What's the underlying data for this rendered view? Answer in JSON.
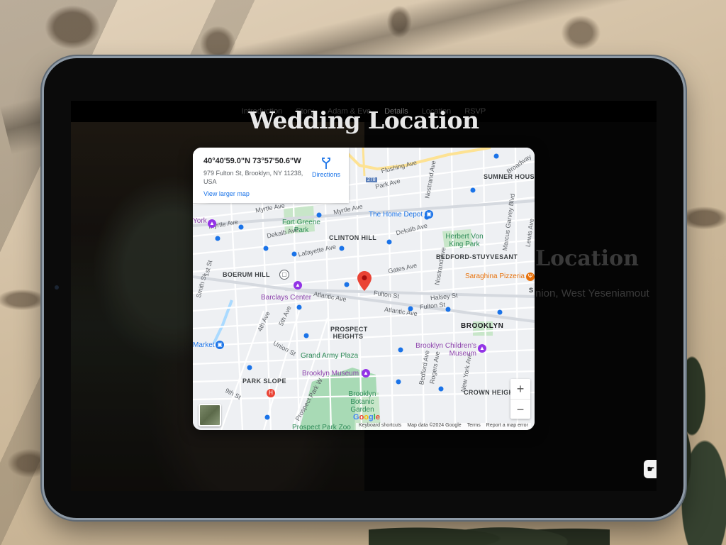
{
  "nav": {
    "items": [
      "Introduction",
      "Story",
      "Adam & Eve",
      "Details",
      "Location",
      "RSVP"
    ],
    "active": "Details"
  },
  "page": {
    "title": "Wedding Location",
    "bg_heading": "Location",
    "bg_address": "nion, West Yeseniamout"
  },
  "map": {
    "info": {
      "coords": "40°40'59.0\"N 73°57'50.6\"W",
      "address": "979 Fulton St, Brooklyn, NY 11238, USA",
      "larger_map": "View larger map",
      "directions": "Directions"
    },
    "labels": {
      "flushing_ave": "Flushing Ave",
      "park_ave": "Park Ave",
      "myrtle_ave_1": "Myrtle Ave",
      "myrtle_ave_2": "Myrtle Ave",
      "myrtle_ave_3": "Myrtle Ave",
      "dekalb_ave_1": "Dekalb Ave",
      "dekalb_ave_2": "Dekalb Ave",
      "lafayette_ave": "Lafayette Ave",
      "gates_ave": "Gates Ave",
      "fulton_st_1": "Fulton St",
      "fulton_st_2": "Fulton St",
      "halsey_st": "Halsey St",
      "atlantic_ave_1": "Atlantic Ave",
      "atlantic_ave_2": "Atlantic Ave",
      "union_st": "Union St",
      "ninth_st": "9th St",
      "fourth_ave": "4th Ave",
      "fifth_ave": "5th Ave",
      "smith_st": "Smith St",
      "first_st": "1st St",
      "prospect_park_w": "Prospect Park W",
      "bedford_ave": "Bedford Ave",
      "rogers_ave": "Rogers Ave",
      "new_york_ave": "New York Ave",
      "nostrand_ave_1": "Nostrand Ave",
      "nostrand_ave_2": "Nostrand Ave",
      "broadway": "Broadway",
      "marcus_garvey": "Marcus Garvey Blvd",
      "lewis_ave": "Lewis Ave",
      "route_278": "278",
      "sumner_houses": "SUMNER HOUSES",
      "clinton_hill": "CLINTON HILL",
      "boerum_hill": "BOERUM HILL",
      "bedford_stuyvesant": "BEDFORD-STUYVESANT",
      "prospect_heights": "PROSPECT HEIGHTS",
      "brooklyn": "BROOKLYN",
      "park_slope": "PARK SLOPE",
      "crown_heights": "CROWN HEIGH",
      "fort_greene_park": "Fort Greene Park",
      "herbert_von_king_park": "Herbert Von King Park",
      "grand_army_plaza": "Grand Army Plaza",
      "brooklyn_botanic_garden": "Brooklyn Botanic Garden",
      "prospect_park_zoo": "Prospect Park Zoo",
      "home_depot": "The Home Depot",
      "barclays_center": "Barclays Center",
      "brooklyn_museum": "Brooklyn Museum",
      "childrens_museum": "Brooklyn Children's Museum",
      "saraghina": "Saraghina Pizzeria",
      "market": "Market",
      "york": "York",
      "s": "S"
    },
    "attribution": {
      "shortcuts": "Keyboard shortcuts",
      "map_data": "Map data ©2024 Google",
      "terms": "Terms",
      "report": "Report a map error"
    },
    "google": "Google",
    "zoom_in": "+",
    "zoom_out": "−"
  },
  "chat_button": "☛",
  "colors": {
    "park": "#c8e6c9",
    "water": "#aadaff",
    "road": "#ffffff",
    "highway": "#fde293",
    "pin": "#ea4335"
  }
}
